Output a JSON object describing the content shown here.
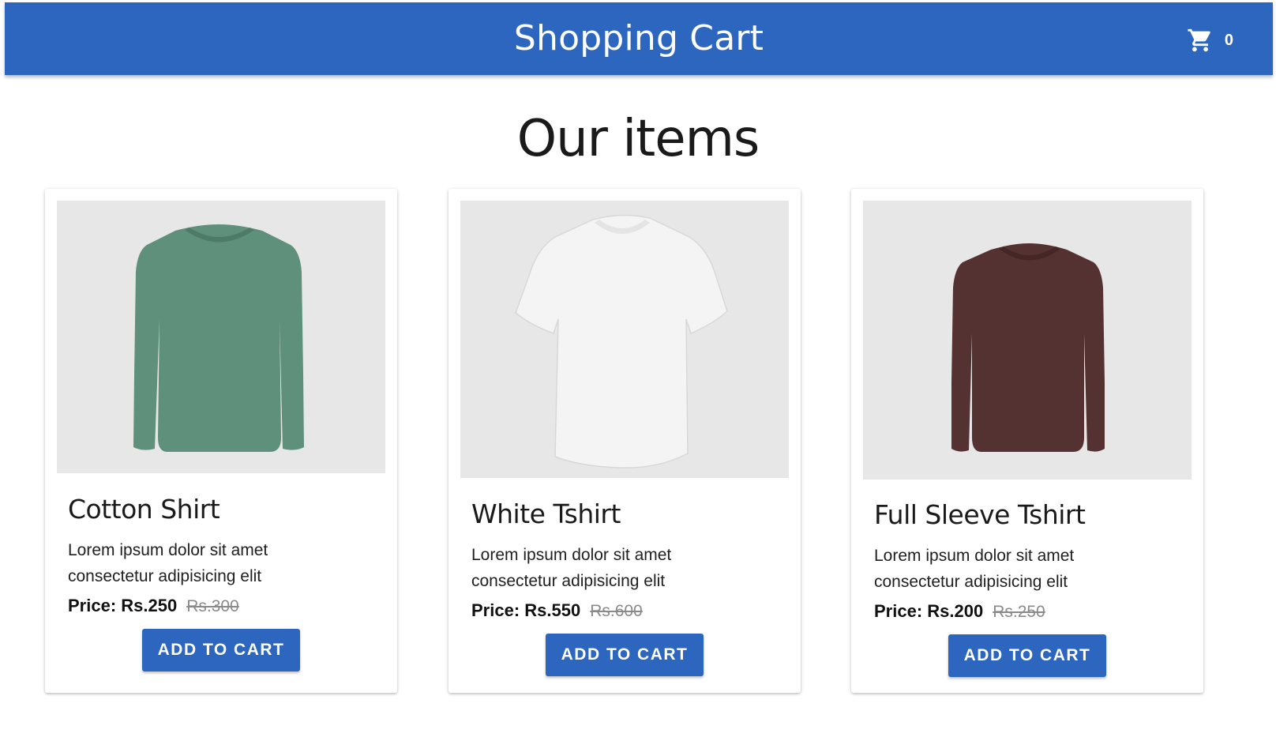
{
  "header": {
    "title": "Shopping Cart",
    "cart_count": "0",
    "accent_color": "#2d66be"
  },
  "section_title": "Our items",
  "products": [
    {
      "name": "Cotton Shirt",
      "description": "Lorem ipsum dolor sit amet consectetur adipisicing elit",
      "price_label": "Price: Rs.250",
      "old_price": "Rs.300",
      "button_label": "ADD TO CART",
      "image": "green-long-sleeve-shirt",
      "shirt_color": "#5f907b"
    },
    {
      "name": "White Tshirt",
      "description": "Lorem ipsum dolor sit amet consectetur adipisicing elit",
      "price_label": "Price: Rs.550",
      "old_price": "Rs.600",
      "button_label": "ADD TO CART",
      "image": "white-short-sleeve-tshirt",
      "shirt_color": "#f4f4f4"
    },
    {
      "name": "Full Sleeve Tshirt",
      "description": "Lorem ipsum dolor sit amet consectetur adipisicing elit",
      "price_label": "Price: Rs.200",
      "old_price": "Rs.250",
      "button_label": "ADD TO CART",
      "image": "maroon-long-sleeve-shirt",
      "shirt_color": "#553232"
    }
  ]
}
